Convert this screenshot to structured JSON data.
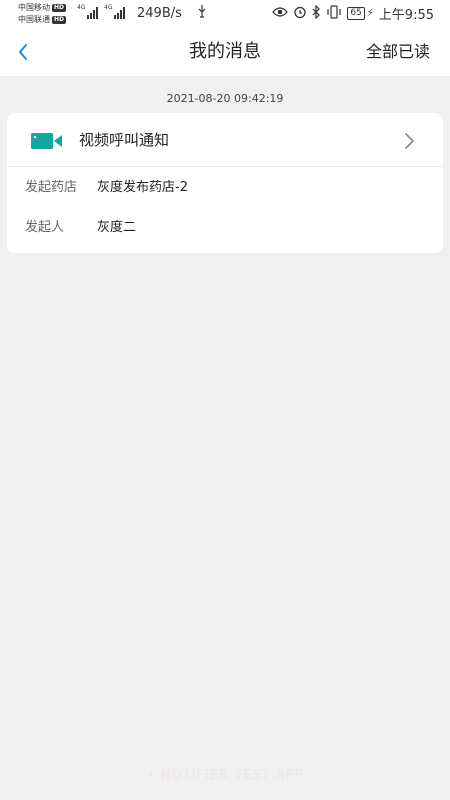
{
  "status_bar": {
    "carrier1": "中国移动",
    "carrier2": "中国联通",
    "hd_badge": "HD",
    "net1": "4G",
    "net2": "4G",
    "speed": "249B/s",
    "battery": "65",
    "time": "上午9:55",
    "icons": [
      "usb-icon",
      "eye-icon",
      "alarm-icon",
      "bluetooth-icon",
      "vibrate-icon",
      "battery-icon",
      "charging-icon"
    ]
  },
  "nav": {
    "title": "我的消息",
    "mark_all_read": "全部已读",
    "back_icon": "chevron-left-icon",
    "accent_color": "#1e88e5"
  },
  "messages": [
    {
      "timestamp": "2021-08-20 09:42:19",
      "title": "视频呼叫通知",
      "icon": "video-camera-icon",
      "icon_color": "#14a6a0",
      "fields": [
        {
          "label": "发起药店",
          "value": "灰度发布药店-2"
        },
        {
          "label": "发起人",
          "value": "灰度二"
        }
      ]
    }
  ],
  "watermark": "• NOTIFIER TEST APP"
}
